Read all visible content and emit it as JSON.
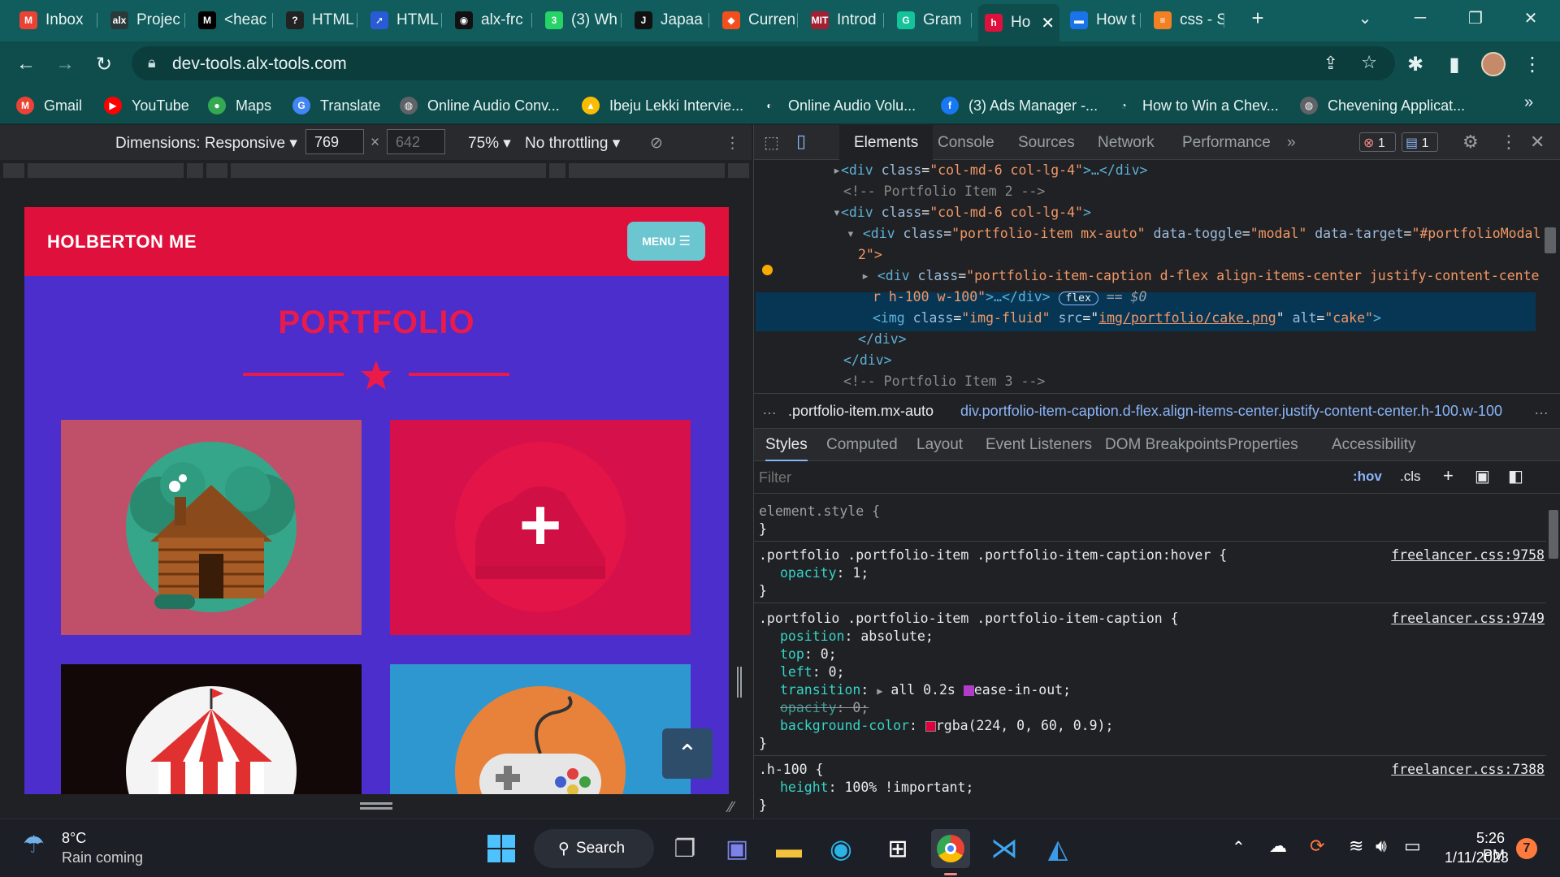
{
  "browser": {
    "tabs": [
      {
        "label": "Inbox",
        "icon": "gmail-icon",
        "color": "#ea4335",
        "glyph": "M"
      },
      {
        "label": "Projec",
        "icon": "alx-icon",
        "color": "#2a3a3a",
        "glyph": "alx"
      },
      {
        "label": "<heac",
        "icon": "medium-icon",
        "color": "#000000",
        "glyph": "M"
      },
      {
        "label": "HTML",
        "icon": "question-icon",
        "color": "#222222",
        "glyph": "?"
      },
      {
        "label": "HTML",
        "icon": "arrow-icon",
        "color": "#2a5bd7",
        "glyph": "➚"
      },
      {
        "label": "alx-frc",
        "icon": "github-icon",
        "color": "#111111",
        "glyph": "◉"
      },
      {
        "label": "(3) Wh",
        "icon": "whatsapp-icon",
        "color": "#25d366",
        "glyph": "3"
      },
      {
        "label": "Japaa",
        "icon": "japaa-icon",
        "color": "#111111",
        "glyph": "J"
      },
      {
        "label": "Curren",
        "icon": "figma-icon",
        "color": "#f24e1e",
        "glyph": "◆"
      },
      {
        "label": "Introd",
        "icon": "mit-icon",
        "color": "#a31f34",
        "glyph": "MIT"
      },
      {
        "label": "Gram",
        "icon": "grammarly-icon",
        "color": "#15c39a",
        "glyph": "G"
      },
      {
        "label": "Ho",
        "icon": "holberton-icon",
        "color": "#e0103c",
        "glyph": "h",
        "active": true
      },
      {
        "label": "How t",
        "icon": "blue-icon",
        "color": "#1a73e8",
        "glyph": "▬"
      },
      {
        "label": "css - S",
        "icon": "stackoverflow-icon",
        "color": "#f48024",
        "glyph": "≡"
      }
    ],
    "new_tab": "+",
    "url": "dev-tools.alx-tools.com",
    "bookmarks": [
      {
        "label": "Gmail",
        "icon": "gmail-icon",
        "color": "#ea4335",
        "glyph": "M"
      },
      {
        "label": "YouTube",
        "icon": "youtube-icon",
        "color": "#ff0000",
        "glyph": "▶"
      },
      {
        "label": "Maps",
        "icon": "maps-icon",
        "color": "#34a853",
        "glyph": "●"
      },
      {
        "label": "Translate",
        "icon": "translate-icon",
        "color": "#4285f4",
        "glyph": "G"
      },
      {
        "label": "Online Audio Conv...",
        "icon": "globe-icon",
        "color": "#5f6368",
        "glyph": "◍"
      },
      {
        "label": "Ibeju Lekki Intervie...",
        "icon": "drive-icon",
        "color": "#fbbc04",
        "glyph": "▲"
      },
      {
        "label": "Online Audio Volu...",
        "icon": "volume-icon",
        "color": "#0f4d4d",
        "glyph": "◐"
      },
      {
        "label": "(3) Ads Manager -...",
        "icon": "facebook-icon",
        "color": "#1877f2",
        "glyph": "f"
      },
      {
        "label": "How to Win a Chev...",
        "icon": "chevening-icon",
        "color": "#0f4d4d",
        "glyph": "◔"
      },
      {
        "label": "Chevening Applicat...",
        "icon": "globe-icon",
        "color": "#5f6368",
        "glyph": "◍"
      }
    ]
  },
  "device_toolbar": {
    "dimensions_label": "Dimensions: Responsive",
    "width": "769",
    "height": "642",
    "zoom": "75%",
    "throttling": "No throttling"
  },
  "site": {
    "brand": "HOLBERTON ME",
    "menu_label": "MENU",
    "section_title": "PORTFOLIO"
  },
  "devtools": {
    "tabs": [
      "Elements",
      "Console",
      "Sources",
      "Network",
      "Performance"
    ],
    "more": "»",
    "errors": "1",
    "messages": "1",
    "dom": {
      "line1": {
        "pre": "▸",
        "open": "<div ",
        "attr": "class",
        "val": "\"col-md-6 col-lg-4\"",
        "close": ">…</div>"
      },
      "line2": "<!-- Portfolio Item 2 -->",
      "line3": {
        "pre": "▾",
        "open": "<div ",
        "attr": "class",
        "val": "\"col-md-6 col-lg-4\"",
        "close": ">"
      },
      "line4a": {
        "pre": "▾",
        "open": "<div ",
        "attr": "class",
        "val": "\"portfolio-item mx-auto\"",
        "attr2": "data-toggle",
        "val2": "\"modal\"",
        "attr3": "data-target",
        "val3": "\"#portfolioModal"
      },
      "line4b": "2\">",
      "line5a": {
        "pre": "▸",
        "open": "<div ",
        "attr": "class",
        "val": "\"portfolio-item-caption d-flex align-items-center justify-content-cente"
      },
      "line5b": {
        "val": "r h-100 w-100\"",
        "close": ">…</div>",
        "badge": "flex",
        "eq": "== $0"
      },
      "line6": {
        "open": "<img ",
        "attr": "class",
        "val": "\"img-fluid\"",
        "attr2": "src",
        "val2": "img/portfolio/cake.png",
        "attr3": "alt",
        "val3": "\"cake\"",
        "close": ">"
      },
      "line7": "</div>",
      "line8": "</div>",
      "line9": "<!-- Portfolio Item 3 -->"
    },
    "breadcrumbs": [
      "…",
      ".portfolio-item.mx-auto",
      "div.portfolio-item-caption.d-flex.align-items-center.justify-content-center.h-100.w-100",
      "…"
    ],
    "style_tabs": [
      "Styles",
      "Computed",
      "Layout",
      "Event Listeners",
      "DOM Breakpoints",
      "Properties",
      "Accessibility"
    ],
    "filter_placeholder": "Filter",
    "hov": ":hov",
    "cls": ".cls",
    "rules": {
      "r0_selector": "element.style {",
      "r0_close": "}",
      "r1_selector": ".portfolio .portfolio-item .portfolio-item-caption:hover {",
      "r1_source": "freelancer.css:9758",
      "r1_p1": "opacity",
      "r1_v1": "1;",
      "r1_close": "}",
      "r2_selector": ".portfolio .portfolio-item .portfolio-item-caption {",
      "r2_source": "freelancer.css:9749",
      "r2_p1": "position",
      "r2_v1": "absolute;",
      "r2_p2": "top",
      "r2_v2": "0;",
      "r2_p3": "left",
      "r2_v3": "0;",
      "r2_p4": "transition",
      "r2_v4": "all 0.2s",
      "r2_v4b": "ease-in-out;",
      "r2_p5": "opacity",
      "r2_v5": "0;",
      "r2_p6": "background-color",
      "r2_v6": "rgba(224, 0, 60, 0.9);",
      "r2_close": "}",
      "r3_selector": ".h-100 {",
      "r3_source": "freelancer.css:7388",
      "r3_p1": "height",
      "r3_v1": "100% !important;",
      "r3_close": "}"
    }
  },
  "taskbar": {
    "weather_temp": "8°C",
    "weather_text": "Rain coming",
    "search": "Search",
    "time": "5:26 PM",
    "date": "1/11/2023",
    "notifications": "7"
  },
  "colors": {
    "site_nav": "#e0103c",
    "site_bg": "#4b2ecc",
    "accent": "#ea1a4a",
    "menu_btn": "#6cc6d0",
    "caption_swatch": "#e0003c"
  }
}
